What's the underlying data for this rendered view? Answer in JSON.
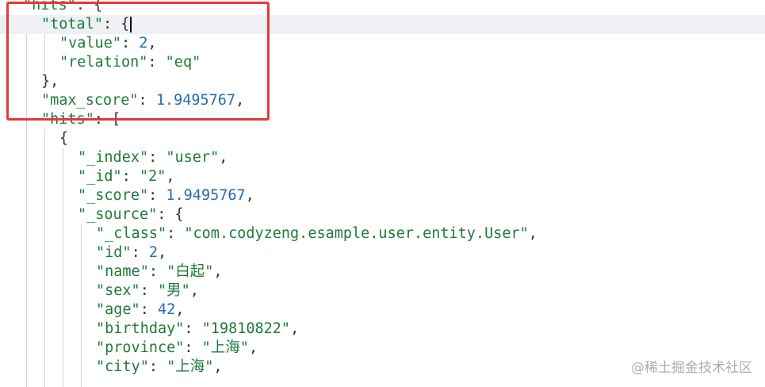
{
  "editor": {
    "active_line": 1,
    "lines": [
      {
        "indent": 1,
        "tokens": [
          {
            "t": "\"hits\"",
            "c": "key"
          },
          {
            "t": ": {",
            "c": "p"
          }
        ]
      },
      {
        "indent": 2,
        "tokens": [
          {
            "t": "\"total\"",
            "c": "key"
          },
          {
            "t": ": {",
            "c": "p"
          }
        ]
      },
      {
        "indent": 3,
        "tokens": [
          {
            "t": "\"value\"",
            "c": "key"
          },
          {
            "t": ": ",
            "c": "p"
          },
          {
            "t": "2",
            "c": "num"
          },
          {
            "t": ",",
            "c": "p"
          }
        ]
      },
      {
        "indent": 3,
        "tokens": [
          {
            "t": "\"relation\"",
            "c": "key"
          },
          {
            "t": ": ",
            "c": "p"
          },
          {
            "t": "\"eq\"",
            "c": "str"
          }
        ]
      },
      {
        "indent": 2,
        "tokens": [
          {
            "t": "},",
            "c": "p"
          }
        ]
      },
      {
        "indent": 2,
        "tokens": [
          {
            "t": "\"max_score\"",
            "c": "key"
          },
          {
            "t": ": ",
            "c": "p"
          },
          {
            "t": "1.9495767",
            "c": "num"
          },
          {
            "t": ",",
            "c": "p"
          }
        ]
      },
      {
        "indent": 2,
        "tokens": [
          {
            "t": "\"hits\"",
            "c": "key"
          },
          {
            "t": ": [",
            "c": "p"
          }
        ]
      },
      {
        "indent": 3,
        "tokens": [
          {
            "t": "{",
            "c": "p"
          }
        ]
      },
      {
        "indent": 4,
        "tokens": [
          {
            "t": "\"_index\"",
            "c": "key"
          },
          {
            "t": ": ",
            "c": "p"
          },
          {
            "t": "\"user\"",
            "c": "str"
          },
          {
            "t": ",",
            "c": "p"
          }
        ]
      },
      {
        "indent": 4,
        "tokens": [
          {
            "t": "\"_id\"",
            "c": "key"
          },
          {
            "t": ": ",
            "c": "p"
          },
          {
            "t": "\"2\"",
            "c": "str"
          },
          {
            "t": ",",
            "c": "p"
          }
        ]
      },
      {
        "indent": 4,
        "tokens": [
          {
            "t": "\"_score\"",
            "c": "key"
          },
          {
            "t": ": ",
            "c": "p"
          },
          {
            "t": "1.9495767",
            "c": "num"
          },
          {
            "t": ",",
            "c": "p"
          }
        ]
      },
      {
        "indent": 4,
        "tokens": [
          {
            "t": "\"_source\"",
            "c": "key"
          },
          {
            "t": ": {",
            "c": "p"
          }
        ]
      },
      {
        "indent": 5,
        "tokens": [
          {
            "t": "\"_class\"",
            "c": "key"
          },
          {
            "t": ": ",
            "c": "p"
          },
          {
            "t": "\"com.codyzeng.esample.user.entity.User\"",
            "c": "str"
          },
          {
            "t": ",",
            "c": "p"
          }
        ]
      },
      {
        "indent": 5,
        "tokens": [
          {
            "t": "\"id\"",
            "c": "key"
          },
          {
            "t": ": ",
            "c": "p"
          },
          {
            "t": "2",
            "c": "num"
          },
          {
            "t": ",",
            "c": "p"
          }
        ]
      },
      {
        "indent": 5,
        "tokens": [
          {
            "t": "\"name\"",
            "c": "key"
          },
          {
            "t": ": ",
            "c": "p"
          },
          {
            "t": "\"白起\"",
            "c": "str"
          },
          {
            "t": ",",
            "c": "p"
          }
        ]
      },
      {
        "indent": 5,
        "tokens": [
          {
            "t": "\"sex\"",
            "c": "key"
          },
          {
            "t": ": ",
            "c": "p"
          },
          {
            "t": "\"男\"",
            "c": "str"
          },
          {
            "t": ",",
            "c": "p"
          }
        ]
      },
      {
        "indent": 5,
        "tokens": [
          {
            "t": "\"age\"",
            "c": "key"
          },
          {
            "t": ": ",
            "c": "p"
          },
          {
            "t": "42",
            "c": "num"
          },
          {
            "t": ",",
            "c": "p"
          }
        ]
      },
      {
        "indent": 5,
        "tokens": [
          {
            "t": "\"birthday\"",
            "c": "key"
          },
          {
            "t": ": ",
            "c": "p"
          },
          {
            "t": "\"19810822\"",
            "c": "str"
          },
          {
            "t": ",",
            "c": "p"
          }
        ]
      },
      {
        "indent": 5,
        "tokens": [
          {
            "t": "\"province\"",
            "c": "key"
          },
          {
            "t": ": ",
            "c": "p"
          },
          {
            "t": "\"上海\"",
            "c": "str"
          },
          {
            "t": ",",
            "c": "p"
          }
        ]
      },
      {
        "indent": 5,
        "tokens": [
          {
            "t": "\"city\"",
            "c": "key"
          },
          {
            "t": ": ",
            "c": "p"
          },
          {
            "t": "\"上海\"",
            "c": "str"
          },
          {
            "t": ",",
            "c": "p"
          }
        ]
      }
    ]
  },
  "watermark": "@稀土掘金技术社区",
  "colors": {
    "key": "#1f7a3a",
    "string": "#1f7a3a",
    "number": "#2a6ab0",
    "punctuation": "#333333",
    "highlight_border": "#e8373b",
    "active_line": "#eef0f4"
  }
}
